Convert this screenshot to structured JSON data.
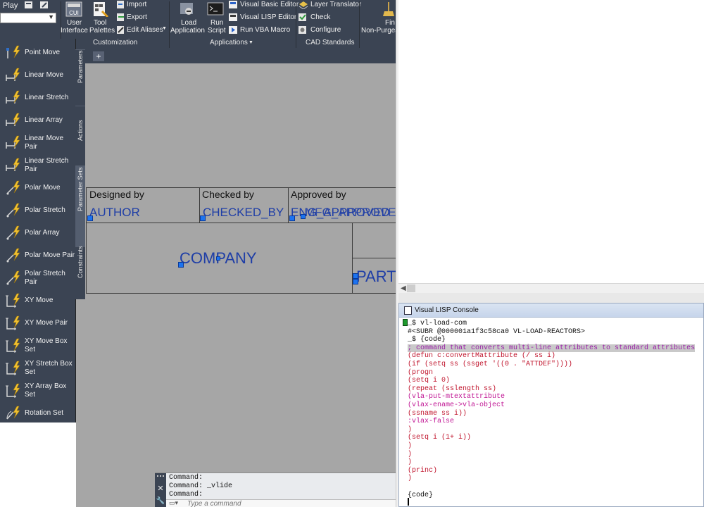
{
  "ribbon": {
    "play_label": "Play",
    "buttons": {
      "user_interface": [
        "User",
        "Interface"
      ],
      "tool_palettes": [
        "Tool",
        "Palettes"
      ],
      "import": "Import",
      "export": "Export",
      "edit_aliases": "Edit Aliases",
      "load_application": [
        "Load",
        "Application"
      ],
      "run_script": [
        "Run",
        "Script"
      ],
      "visual_basic_editor": "Visual Basic Editor",
      "visual_lisp_editor": "Visual LISP Editor",
      "run_vba_macro": "Run VBA Macro",
      "layer_translator": "Layer Translator",
      "check": "Check",
      "configure": "Configure",
      "find_non_purgeable": [
        "Fin",
        "Non-Purgea"
      ]
    },
    "panels": {
      "customization": "Customization",
      "applications": "Applications",
      "cad_standards": "CAD Standards"
    },
    "cui_badge": "CUI"
  },
  "palette": {
    "items": [
      [
        "Point Move"
      ],
      [
        "Linear Move"
      ],
      [
        "Linear Stretch"
      ],
      [
        "Linear Array"
      ],
      [
        "Linear Move",
        "Pair"
      ],
      [
        "Linear Stretch",
        "Pair"
      ],
      [
        "Polar Move"
      ],
      [
        "Polar Stretch"
      ],
      [
        "Polar Array"
      ],
      [
        "Polar Move Pair"
      ],
      [
        "Polar Stretch",
        "Pair"
      ],
      [
        "XY Move"
      ],
      [
        "XY Move Pair"
      ],
      [
        "XY Move Box",
        "Set"
      ],
      [
        "XY Stretch Box",
        "Set"
      ],
      [
        "XY Array Box",
        "Set"
      ],
      [
        "Rotation Set"
      ]
    ],
    "tabs": [
      "Parameters",
      "Actions",
      "Parameter Sets",
      "Constraints"
    ],
    "active_tab": "Parameter Sets"
  },
  "doc_tabs": {
    "add_label": "+"
  },
  "title_block": {
    "designed_by_label": "Designed by",
    "checked_by_label": "Checked by",
    "approved_by_label": "Approved by",
    "author": "AUTHOR",
    "checked_by": "CHECKED_BY",
    "approved_by_a": "ENG_APPROVED",
    "approved_by_b": "MFG_APPROVED_B",
    "company": "COMPANY",
    "part": "PART"
  },
  "command_line": {
    "history": [
      "Command:",
      "Command: _vlide",
      "Command:"
    ],
    "placeholder": "Type a command"
  },
  "vlisp": {
    "title": "Visual LISP Console",
    "lines": [
      {
        "text": "_$ vl-load-com",
        "style": "black"
      },
      {
        "text": "#<SUBR @000001a1f3c58ca0 VL-LOAD-REACTORS>",
        "style": "black"
      },
      {
        "text": "_$ {code}",
        "style": "black"
      },
      {
        "text": "; command that converts multi-line attributes to standard attributes",
        "style": "comment"
      },
      {
        "text": "(defun c:convertMattribute (/ ss i)",
        "style": "red"
      },
      {
        "text": "(if (setq ss (ssget '((0 . \"ATTDEF\"))))",
        "style": "red"
      },
      {
        "text": "(progn",
        "style": "red"
      },
      {
        "text": "(setq i 0)",
        "style": "red"
      },
      {
        "text": "(repeat (sslength ss)",
        "style": "red"
      },
      {
        "text": "(vla-put-mtextattribute",
        "style": "magenta"
      },
      {
        "text": "(vlax-ename->vla-object",
        "style": "magenta"
      },
      {
        "text": "(ssname ss i))",
        "style": "red"
      },
      {
        "text": ":vlax-false",
        "style": "magenta"
      },
      {
        "text": ")",
        "style": "red"
      },
      {
        "text": "(setq i (1+ i))",
        "style": "red"
      },
      {
        "text": ")",
        "style": "red"
      },
      {
        "text": ")",
        "style": "red"
      },
      {
        "text": ")",
        "style": "red"
      },
      {
        "text": "(princ)",
        "style": "red"
      },
      {
        "text": ")",
        "style": "red"
      },
      {
        "text": "",
        "style": "black"
      },
      {
        "text": "{code}",
        "style": "black"
      }
    ]
  },
  "colors": {
    "ribbon_bg": "#3b4453",
    "drawing_bg": "#a6a6a6",
    "attribute_blue": "#1f3ea6",
    "grip_blue": "#1c73f0"
  }
}
